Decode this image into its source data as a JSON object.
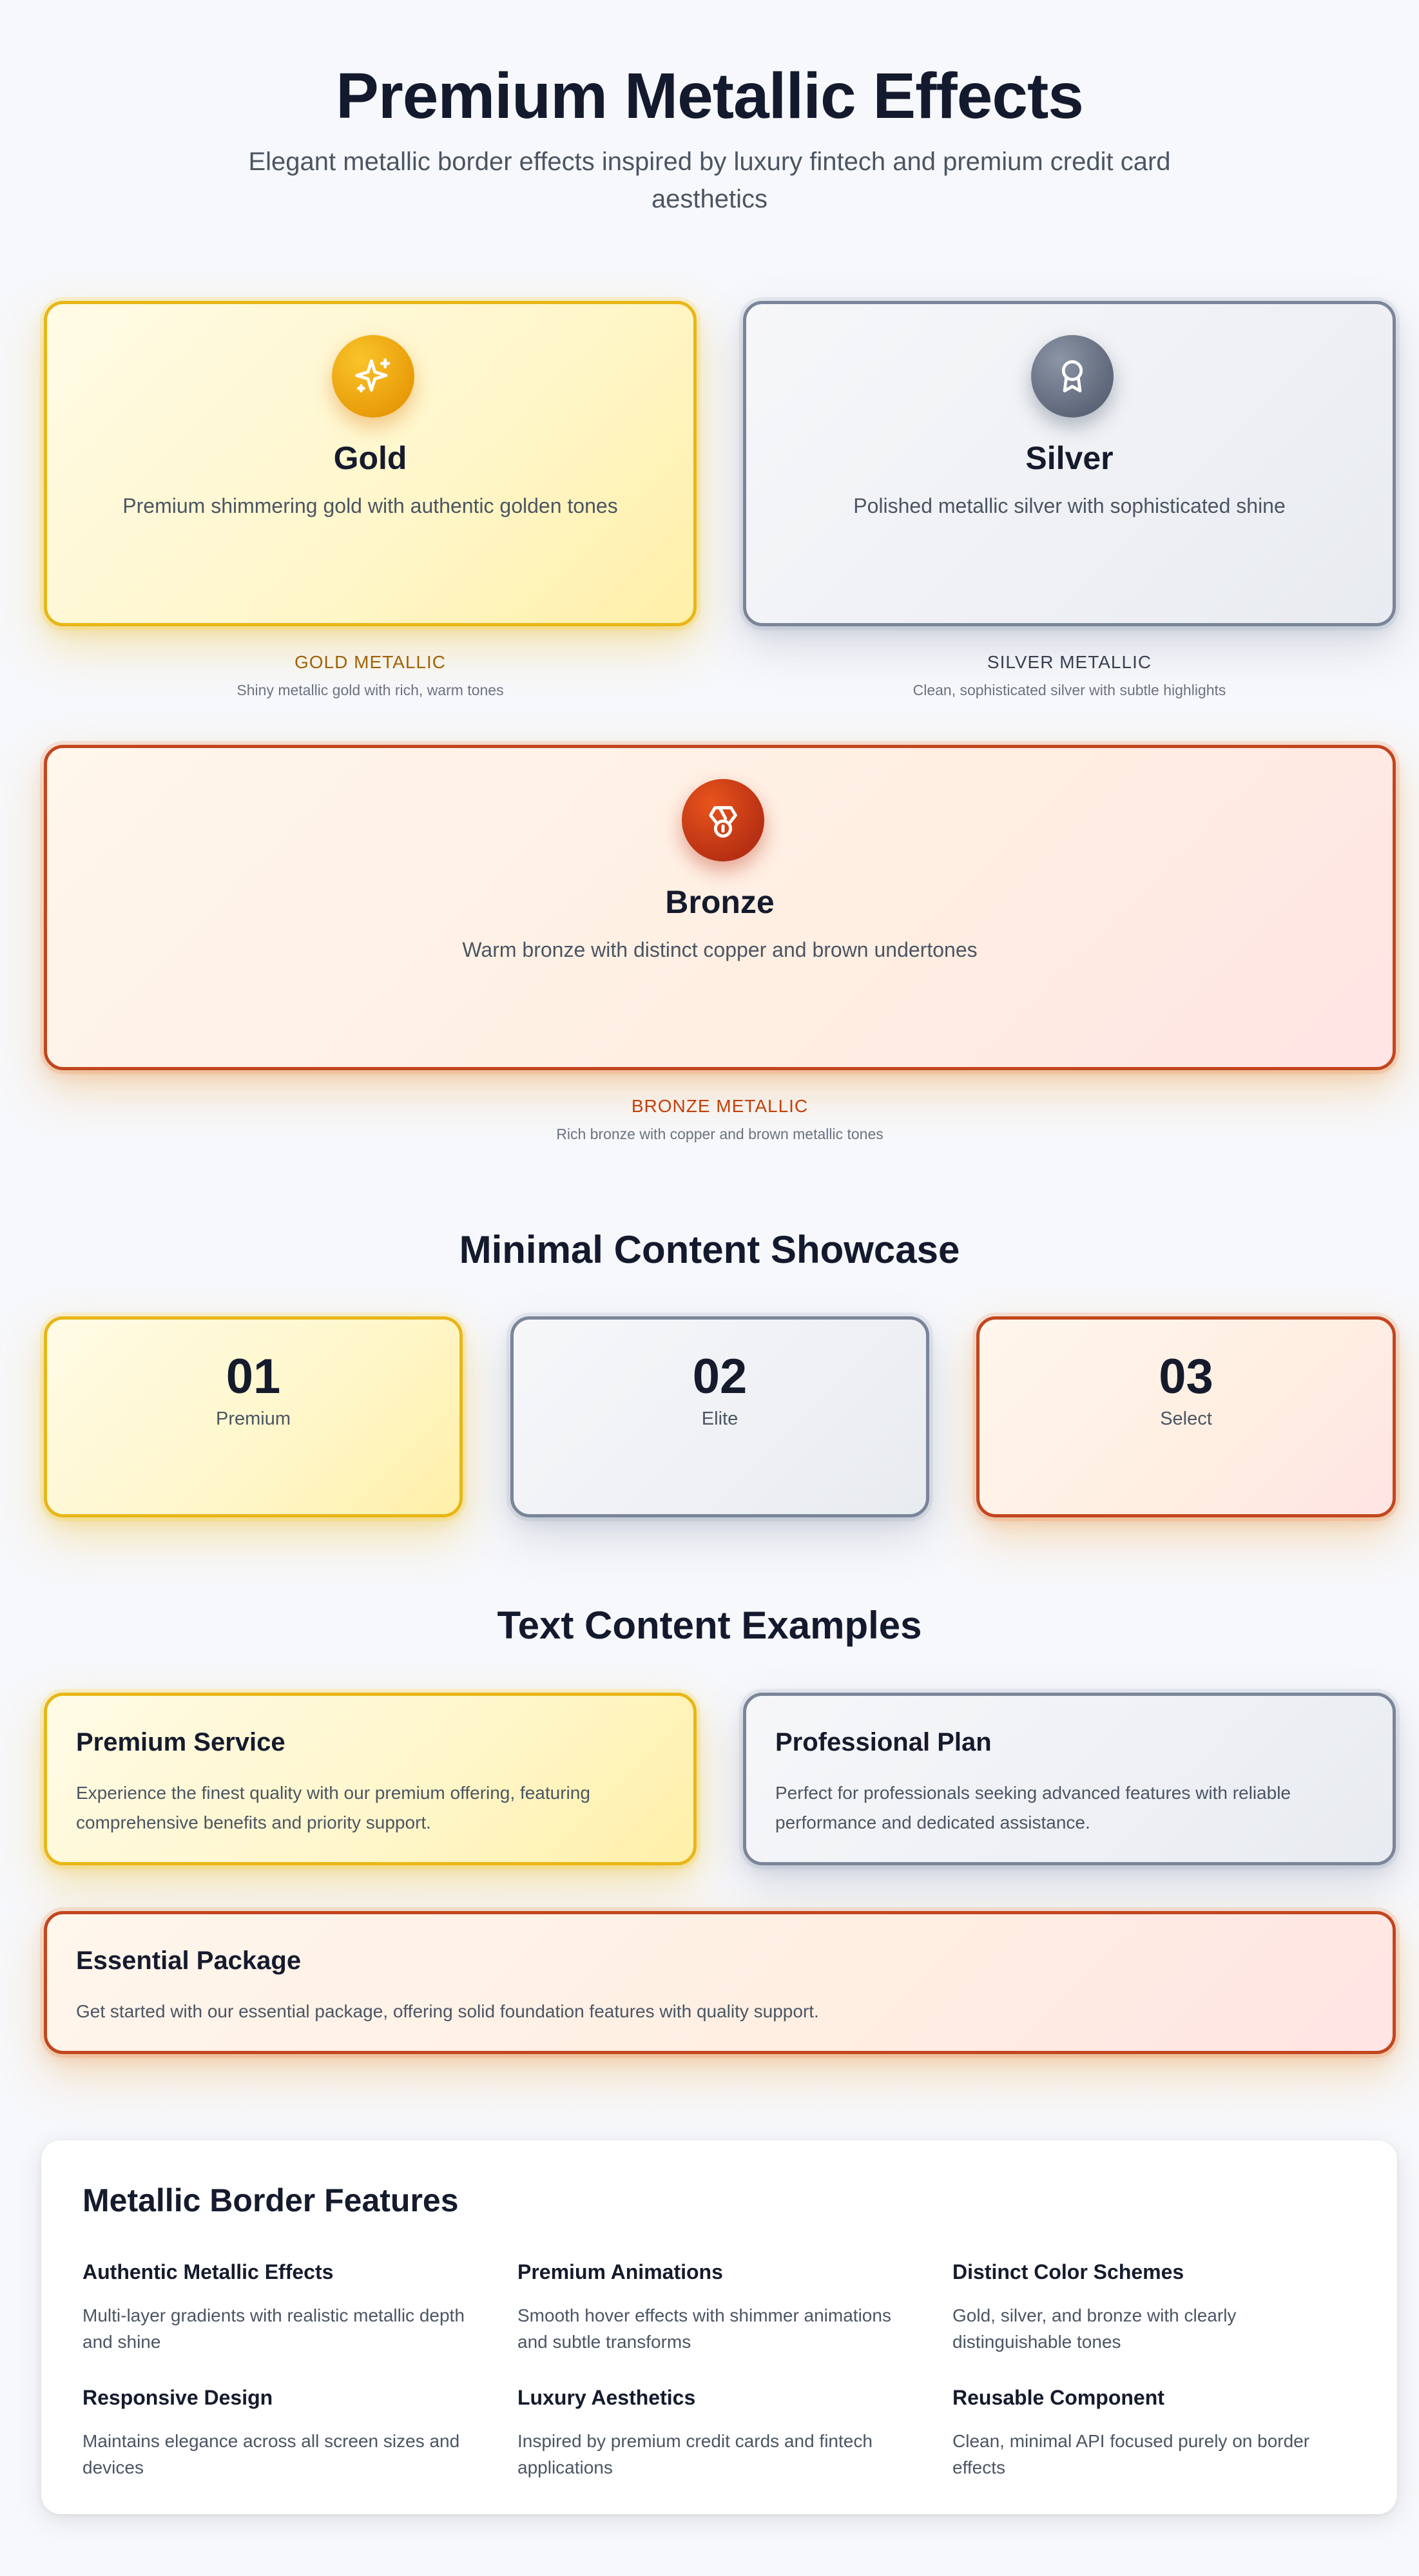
{
  "header": {
    "title": "Premium Metallic Effects",
    "subtitle": "Elegant metallic border effects inspired by luxury fintech and premium credit card aesthetics"
  },
  "metal_cards": {
    "gold": {
      "icon": "sparkles-icon",
      "title": "Gold",
      "description": "Premium shimmering gold with authentic golden tones",
      "caption_label": "GOLD METALLIC",
      "caption_desc": "Shiny metallic gold with rich, warm tones"
    },
    "silver": {
      "icon": "award-icon",
      "title": "Silver",
      "description": "Polished metallic silver with sophisticated shine",
      "caption_label": "SILVER METALLIC",
      "caption_desc": "Clean, sophisticated silver with subtle highlights"
    },
    "bronze": {
      "icon": "medal-icon",
      "title": "Bronze",
      "description": "Warm bronze with distinct copper and brown undertones",
      "caption_label": "BRONZE METALLIC",
      "caption_desc": "Rich bronze with copper and brown metallic tones"
    }
  },
  "minimal": {
    "title": "Minimal Content Showcase",
    "items": [
      {
        "number": "01",
        "label": "Premium"
      },
      {
        "number": "02",
        "label": "Elite"
      },
      {
        "number": "03",
        "label": "Select"
      }
    ]
  },
  "text_examples": {
    "title": "Text Content Examples",
    "items": [
      {
        "title": "Premium Service",
        "body": "Experience the finest quality with our premium offering, featuring comprehensive benefits and priority support."
      },
      {
        "title": "Professional Plan",
        "body": "Perfect for professionals seeking advanced features with reliable performance and dedicated assistance."
      },
      {
        "title": "Essential Package",
        "body": "Get started with our essential package, offering solid foundation features with quality support."
      }
    ]
  },
  "features": {
    "title": "Metallic Border Features",
    "items": [
      {
        "title": "Authentic Metallic Effects",
        "desc": "Multi-layer gradients with realistic metallic depth and shine"
      },
      {
        "title": "Premium Animations",
        "desc": "Smooth hover effects with shimmer animations and subtle transforms"
      },
      {
        "title": "Distinct Color Schemes",
        "desc": "Gold, silver, and bronze with clearly distinguishable tones"
      },
      {
        "title": "Responsive Design",
        "desc": "Maintains elegance across all screen sizes and devices"
      },
      {
        "title": "Luxury Aesthetics",
        "desc": "Inspired by premium credit cards and fintech applications"
      },
      {
        "title": "Reusable Component",
        "desc": "Clean, minimal API focused purely on border effects"
      }
    ]
  },
  "colors": {
    "gold_border": "#e8b617",
    "silver_border": "#7a8599",
    "bronze_border": "#c2461f",
    "gold_caption": "#a16207",
    "silver_caption": "#374151",
    "bronze_caption": "#c2410c"
  }
}
